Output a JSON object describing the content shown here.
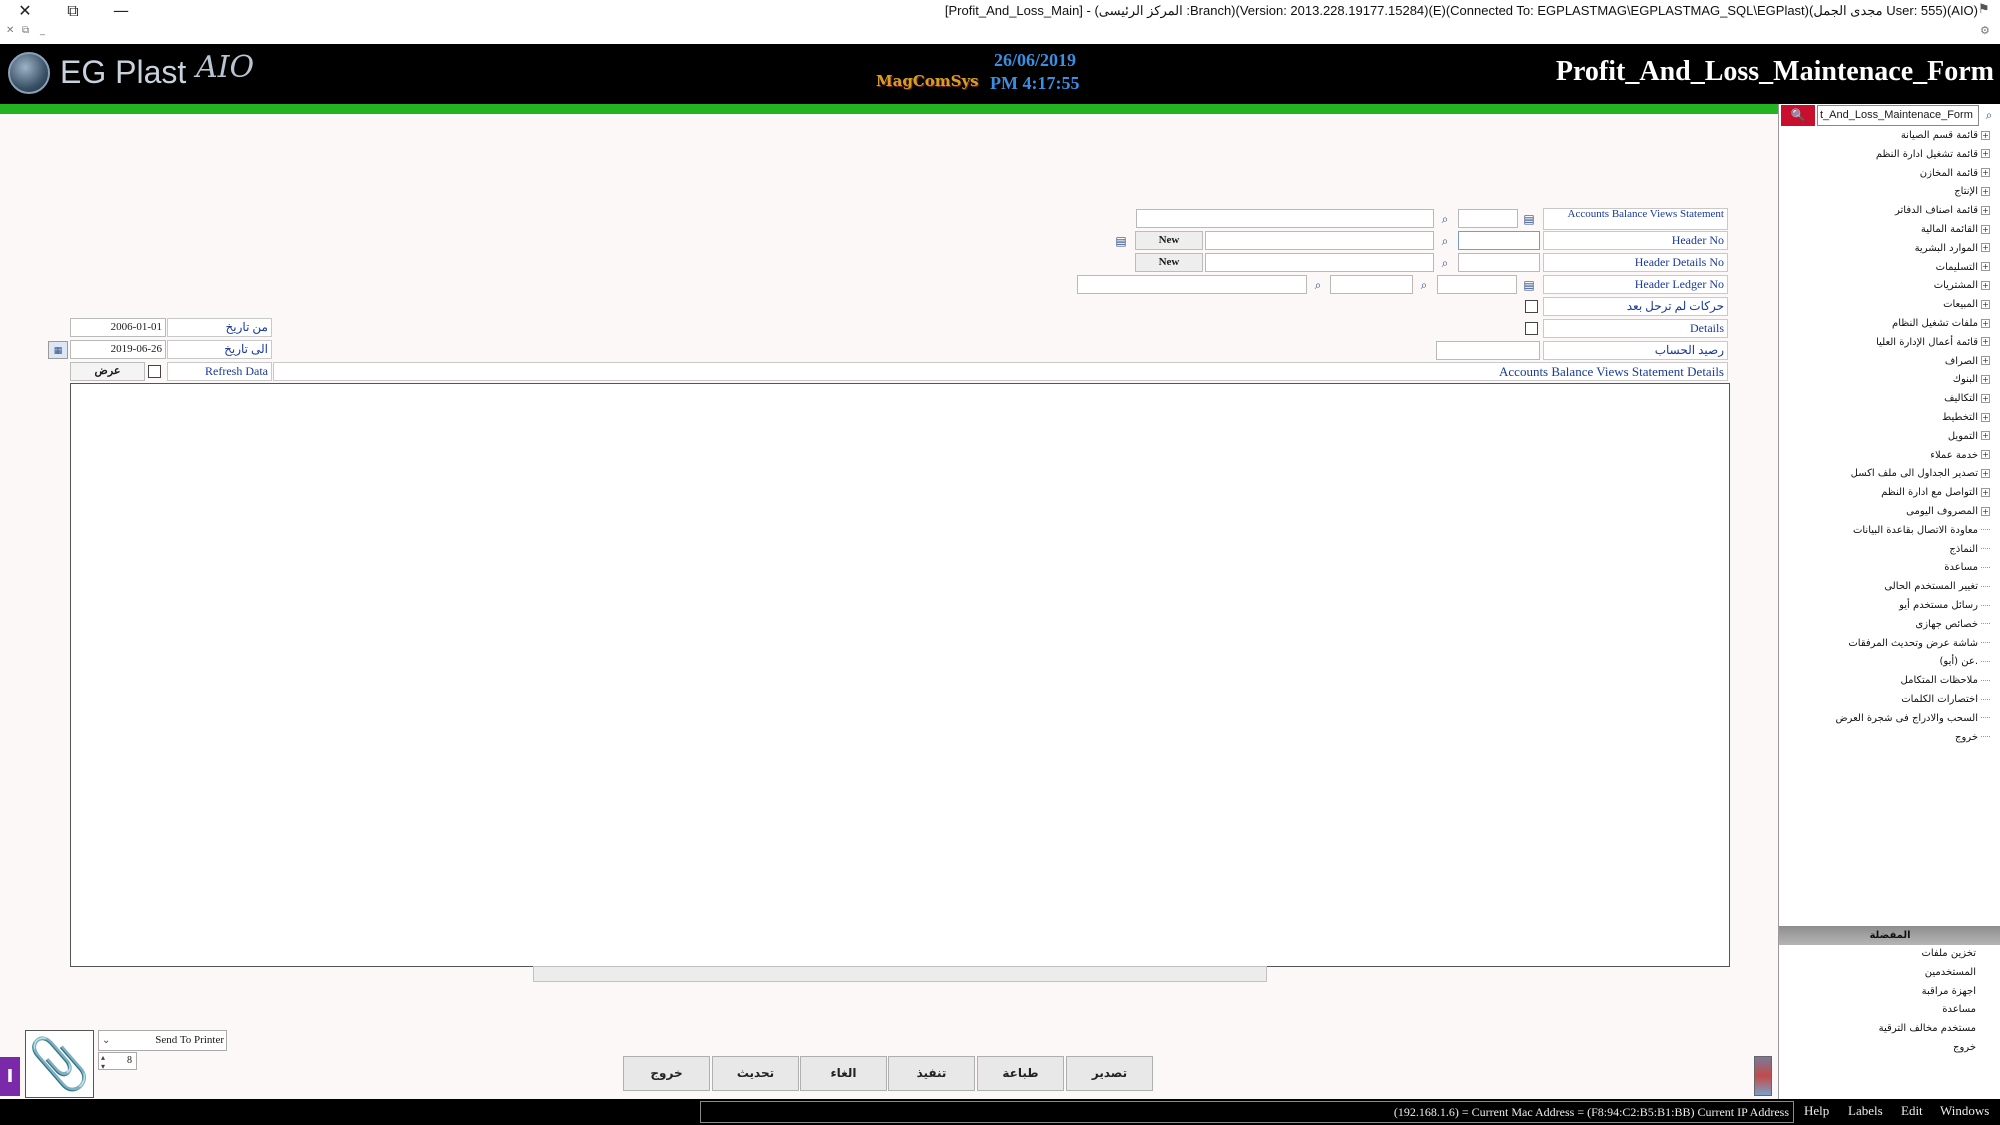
{
  "window": {
    "title": "[Profit_And_Loss_Main] - (المركز الرئيسى :Branch)(Version: 2013.228.19177.15284)(E)(Connected To: EGPLASTMAG\\EGPLASTMAG_SQL\\EGPlast)(مجدى الجمل User: 555)(AIO)",
    "close": "✕",
    "restore": "⧉",
    "minimize": "—",
    "sub_controls": [
      "✕",
      "⧉",
      "_"
    ]
  },
  "header": {
    "brand": "EG Plast",
    "brand_suffix": "AIO",
    "company": "MagComSys",
    "date": "26/06/2019",
    "time": "PM 4:17:55",
    "form_title": "Profit_And_Loss_Maintenace_Form"
  },
  "form": {
    "statement_label": "Accounts Balance Views Statement",
    "header_no_label": "Header No",
    "header_details_label": "Header Details No",
    "header_ledger_label": "Header Ledger No",
    "unposted_label": "حركات لم ترحل بعد",
    "details_label": "Details",
    "account_balance_label": "رصيد الحساب",
    "new_label": "New",
    "from_date_label": "من تاريخ",
    "from_date": "2006-01-01",
    "to_date_label": "الى تاريخ",
    "to_date": "2019-06-26",
    "refresh_label": "Refresh Data",
    "show_label": "عرض",
    "grid_title": "Accounts Balance Views Statement Details"
  },
  "actions": {
    "export": "تصدير",
    "print": "طباعة",
    "execute": "تنفيذ",
    "cancel": "الغاء",
    "update": "تحديث",
    "exit": "خروج"
  },
  "printer": {
    "selected": "Send To Printer",
    "copies": "8"
  },
  "status": {
    "ip_text": "(192.168.1.6) = Current Mac Address = (F8:94:C2:B5:B1:BB) Current IP Address",
    "menu": [
      "Help",
      "Labels",
      "Edit",
      "Windows"
    ]
  },
  "tree": {
    "search_value": "t_And_Loss_Maintenace_Form",
    "items": [
      {
        "label": "قائمة قسم الصيانة",
        "expandable": true
      },
      {
        "label": "قائمة تشغيل ادارة النظم",
        "expandable": true
      },
      {
        "label": "قائمة المخازن",
        "expandable": true
      },
      {
        "label": "الإنتاج",
        "expandable": true
      },
      {
        "label": "قائمة اصناف الدفاتر",
        "expandable": true
      },
      {
        "label": "القائمة المالية",
        "expandable": true
      },
      {
        "label": "الموارد البشرية",
        "expandable": true
      },
      {
        "label": "التسليمات",
        "expandable": true
      },
      {
        "label": "المشتريات",
        "expandable": true
      },
      {
        "label": "المبيعات",
        "expandable": true
      },
      {
        "label": "ملفات تشغيل النظام",
        "expandable": true
      },
      {
        "label": "قائمة أعمال الإدارة العليا",
        "expandable": true
      },
      {
        "label": "الصراف",
        "expandable": true
      },
      {
        "label": "البنوك",
        "expandable": true
      },
      {
        "label": "التكاليف",
        "expandable": true
      },
      {
        "label": "التخطيط",
        "expandable": true
      },
      {
        "label": "التمويل",
        "expandable": true
      },
      {
        "label": "خدمة عملاء",
        "expandable": true
      },
      {
        "label": "تصدير الجداول الى ملف اكسل",
        "expandable": true
      },
      {
        "label": "التواصل مع ادارة النظم",
        "expandable": true
      },
      {
        "label": "المصروف اليومى",
        "expandable": true
      },
      {
        "label": "معاودة الاتصال بقاعدة البيانات",
        "expandable": false
      },
      {
        "label": "النماذج",
        "expandable": false
      },
      {
        "label": "مساعدة",
        "expandable": false
      },
      {
        "label": "تغيير المستخدم الحالى",
        "expandable": false
      },
      {
        "label": "رسائل مستخدم أيو",
        "expandable": false
      },
      {
        "label": "خصائص جهازى",
        "expandable": false
      },
      {
        "label": "شاشة عرض وتحديث المرفقات",
        "expandable": false
      },
      {
        "label": "عن (أيو).",
        "expandable": false
      },
      {
        "label": "ملاحظات المتكامل",
        "expandable": false
      },
      {
        "label": "اختصارات الكلمات",
        "expandable": false
      },
      {
        "label": "السحب والادراج فى شجرة العرض",
        "expandable": false
      },
      {
        "label": "خروج",
        "expandable": false
      }
    ],
    "favorites_header": "المفضلة",
    "favorites": [
      "تخزين ملفات",
      "المستخدمين",
      "اجهزة مراقبة",
      "مساعدة",
      "مستخدم مخالف الترقية",
      "خروج"
    ]
  }
}
